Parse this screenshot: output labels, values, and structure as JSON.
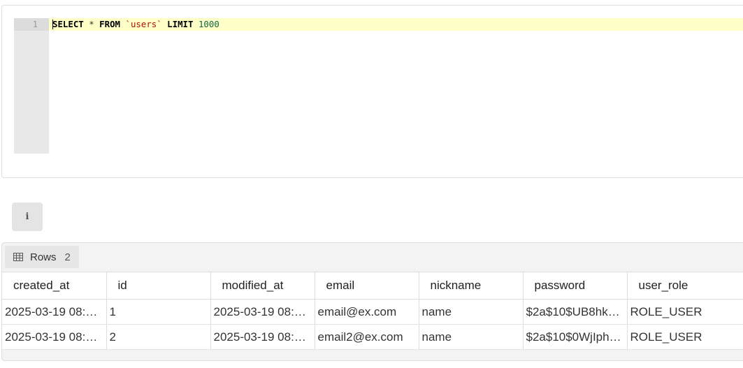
{
  "editor": {
    "line_number": "1",
    "code": {
      "select_kw": "SELECT",
      "star": "*",
      "from_kw": "FROM",
      "table_name": "`users`",
      "limit_kw": "LIMIT",
      "limit_value": "1000"
    }
  },
  "info_button": {
    "icon": "info-icon",
    "glyph": "i"
  },
  "results": {
    "tab_label": "Rows",
    "row_count": "2",
    "columns": [
      "created_at",
      "id",
      "modified_at",
      "email",
      "nickname",
      "password",
      "user_role"
    ],
    "rows": [
      [
        "2025-03-19 08:…",
        "1",
        "2025-03-19 08:…",
        "email@ex.com",
        "name",
        "$2a$10$UB8hk…",
        "ROLE_USER"
      ],
      [
        "2025-03-19 08:…",
        "2",
        "2025-03-19 08:…",
        "email2@ex.com",
        "name",
        "$2a$10$0WjIph…",
        "ROLE_USER"
      ]
    ]
  }
}
